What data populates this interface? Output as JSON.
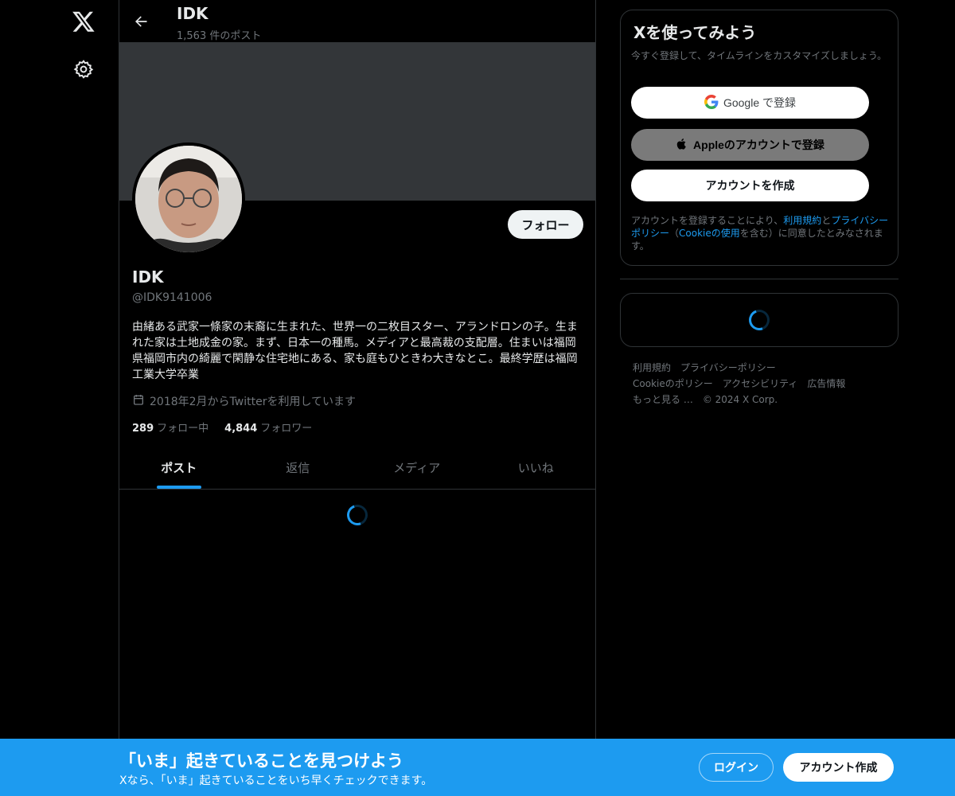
{
  "nav": {
    "logo_icon": "x-logo-icon",
    "settings_icon": "gear-icon"
  },
  "header": {
    "name": "IDK",
    "post_count": "1,563 件のポスト"
  },
  "profile": {
    "name": "IDK",
    "handle": "@IDK9141006",
    "follow_label": "フォロー",
    "bio": "由緒ある武家一條家の末裔に生まれた、世界一の二枚目スター、アランドロンの子。生まれた家は土地成金の家。まず、日本一の種馬。メディアと最高裁の支配層。住まいは福岡県福岡市内の綺麗で閑静な住宅地にある、家も庭もひときわ大きなとこ。最終学歴は福岡工業大学卒業",
    "joined": "2018年2月からTwitterを利用しています",
    "following_count": "289",
    "following_label": "フォロー中",
    "followers_count": "4,844",
    "followers_label": "フォロワー"
  },
  "tabs": [
    {
      "label": "ポスト",
      "active": true
    },
    {
      "label": "返信",
      "active": false
    },
    {
      "label": "メディア",
      "active": false
    },
    {
      "label": "いいね",
      "active": false
    }
  ],
  "signup": {
    "title": "Xを使ってみよう",
    "subtitle": "今すぐ登録して、タイムラインをカスタマイズしましょう。",
    "google_label": "Google で登録",
    "apple_label": "Appleのアカウントで登録",
    "create_label": "アカウントを作成",
    "terms_pre": "アカウントを登録することにより、",
    "terms_link1": "利用規約",
    "terms_and": "と",
    "terms_link2": "プライバシーポリシー",
    "terms_paren_open": "（",
    "terms_link3": "Cookieの使用",
    "terms_post": "を含む）に同意したとみなされます。"
  },
  "footer": {
    "links": [
      "利用規約",
      "プライバシーポリシー",
      "Cookieのポリシー",
      "アクセシビリティ",
      "広告情報",
      "もっと見る …"
    ],
    "copyright": "© 2024 X Corp."
  },
  "bottom_bar": {
    "title": "「いま」起きていることを見つけよう",
    "subtitle": "Xなら、「いま」起きていることをいち早くチェックできます。",
    "login_label": "ログイン",
    "signup_label": "アカウント作成"
  },
  "colors": {
    "accent": "#1d9bf0",
    "background": "#000000",
    "banner": "#333639"
  }
}
